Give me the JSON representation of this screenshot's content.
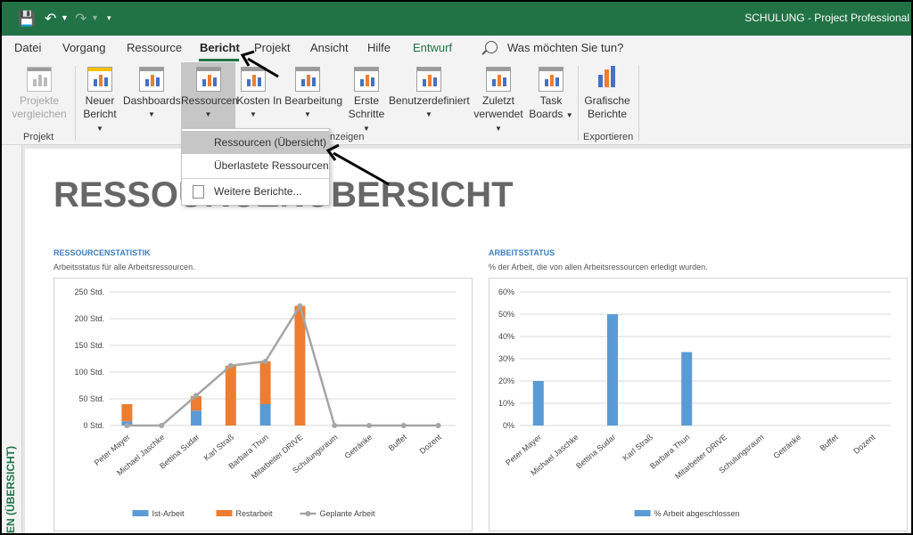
{
  "window": {
    "title": "SCHULUNG  -  Project Professional"
  },
  "menu": {
    "tabs": [
      {
        "label": "Datei"
      },
      {
        "label": "Vorgang"
      },
      {
        "label": "Ressource"
      },
      {
        "label": "Bericht"
      },
      {
        "label": "Projekt"
      },
      {
        "label": "Ansicht"
      },
      {
        "label": "Hilfe"
      },
      {
        "label": "Entwurf"
      }
    ],
    "search_placeholder": "Was möchten Sie tun?"
  },
  "ribbon": {
    "projekt_vergleichen": "Projekte\nvergleichen",
    "projekt_vergleichen_l1": "Projekte",
    "projekt_vergleichen_l2": "vergleichen",
    "neuer_bericht_l1": "Neuer",
    "neuer_bericht_l2": "Bericht",
    "dashboards": "Dashboards",
    "ressourcen": "Ressourcen",
    "kosten": "Kosten",
    "in_bearbeitung": "In Bearbeitung",
    "erste_schritte_l1": "Erste",
    "erste_schritte_l2": "Schritte",
    "benutzerdefiniert": "Benutzerdefiniert",
    "zuletzt_l1": "Zuletzt",
    "zuletzt_l2": "verwendet",
    "task_boards_l1": "Task",
    "task_boards_l2": "Boards",
    "grafische_l1": "Grafische",
    "grafische_l2": "Berichte",
    "group_projekt": "Projekt",
    "group_anzeigen": "nzeigen",
    "group_exportieren": "Exportieren"
  },
  "dropdown": {
    "items": [
      {
        "label": "Ressourcen (Übersicht)"
      },
      {
        "label": "Überlastete Ressourcen"
      },
      {
        "label": "Weitere Berichte..."
      }
    ]
  },
  "report": {
    "title": "RESSOURCENÜBERSICHT",
    "sidebar_label": "EN (ÜBERSICHT)",
    "left": {
      "heading": "RESSOURCENSTATISTIK",
      "subtitle": "Arbeitsstatus für alle Arbeitsressourcen."
    },
    "right": {
      "heading": "ARBEITSSTATUS",
      "subtitle": "% der Arbeit, die von allen Arbeitsressourcen erledigt wurden."
    }
  },
  "chart_data": [
    {
      "type": "bar",
      "stacked": true,
      "categories": [
        "Peter Mayer",
        "Michael Jaschke",
        "Bettina Sudar",
        "Karl Straß",
        "Barbara Thun",
        "Mitarbeiter DRIVE",
        "Schulungsraum",
        "Getränke",
        "Buffet",
        "Dozent"
      ],
      "series": [
        {
          "name": "Ist-Arbeit",
          "type": "bar",
          "color": "#5b9bd5",
          "values": [
            8,
            0,
            28,
            0,
            40,
            0,
            0,
            0,
            0,
            0
          ]
        },
        {
          "name": "Restarbeit",
          "type": "bar",
          "color": "#ed7d31",
          "values": [
            32,
            0,
            27,
            112,
            80,
            224,
            0,
            0,
            0,
            0
          ]
        },
        {
          "name": "Geplante Arbeit",
          "type": "line",
          "color": "#a5a5a5",
          "values": [
            0,
            0,
            56,
            112,
            120,
            224,
            0,
            0,
            0,
            0
          ]
        }
      ],
      "ylim": [
        0,
        250
      ],
      "yticks": [
        "0 Std.",
        "50 Std.",
        "100 Std.",
        "150 Std.",
        "200 Std.",
        "250 Std."
      ],
      "legend": "bottom"
    },
    {
      "type": "bar",
      "categories": [
        "Peter Mayer",
        "Michael Jaschke",
        "Bettina Sudar",
        "Karl Straß",
        "Barbara Thun",
        "Mitarbeiter DRIVE",
        "Schulungsraum",
        "Getränke",
        "Buffet",
        "Dozent"
      ],
      "series": [
        {
          "name": "% Arbeit abgeschlossen",
          "color": "#5b9bd5",
          "values": [
            20,
            0,
            50,
            0,
            33,
            0,
            0,
            0,
            0,
            0
          ]
        }
      ],
      "ylim": [
        0,
        60
      ],
      "yticks": [
        "0%",
        "10%",
        "20%",
        "30%",
        "40%",
        "50%",
        "60%"
      ],
      "legend": "bottom"
    }
  ]
}
